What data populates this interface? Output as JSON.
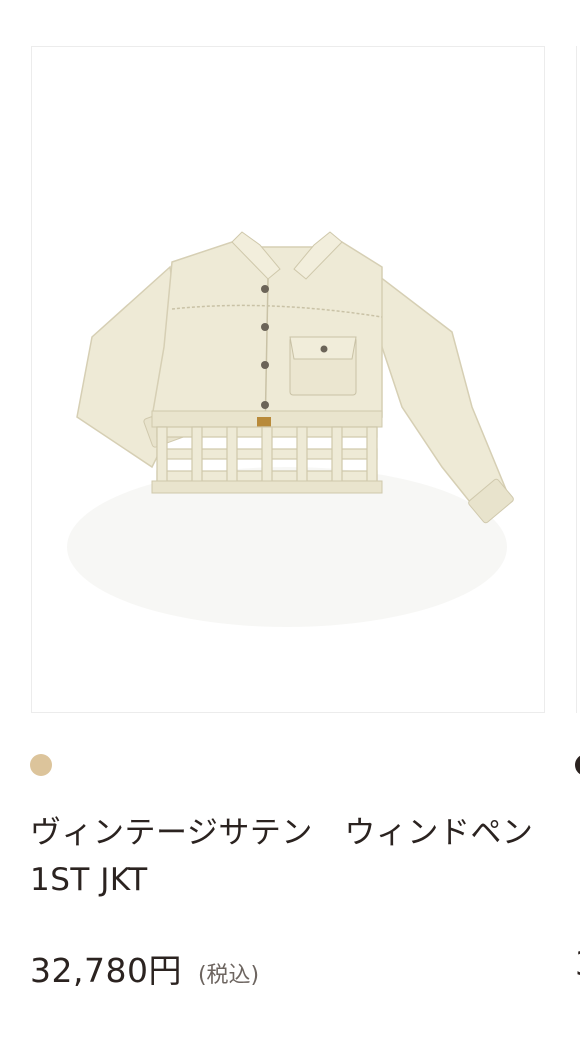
{
  "product": {
    "image_alt": "vintage satin windowpane 1st jacket",
    "color_swatch": "#dcc49b",
    "title": "ヴィンテージサテン　ウィンドペン1ST JKT",
    "price": "32,780円",
    "tax_note": "(税込)"
  },
  "next_product": {
    "color_swatch": "#2b2320",
    "price_fragment": "3"
  },
  "colors": {
    "jacket": "#eeead6",
    "jacket_shadow": "#ddd7bf",
    "stitch": "#c9c2a6",
    "button": "#6b6458"
  }
}
